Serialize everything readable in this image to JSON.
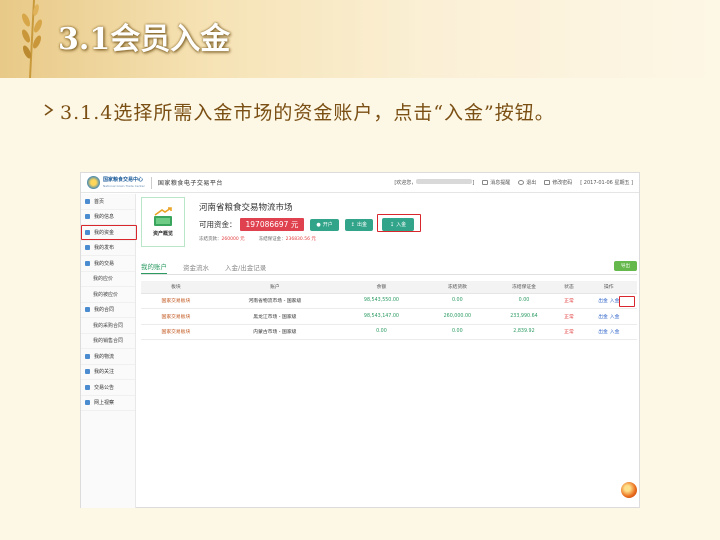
{
  "slide": {
    "title": "3.1会员入金",
    "subtitle": "3.1.4选择所需入金市场的资金账户，点击“入金”按钮。"
  },
  "app": {
    "logo_cn": "国家粮食交易中心",
    "logo_en": "National Grain Trade Center",
    "platform": "国家粮食电子交易平台",
    "welcome": "[欢迎您，",
    "messages": "消息提醒",
    "logout": "退出",
    "change_password": "修改密码",
    "date": "[ 2017-01-06 星期五 ]"
  },
  "sidebar": {
    "items": [
      {
        "label": "首页",
        "sub": false
      },
      {
        "label": "我的信息",
        "sub": false
      },
      {
        "label": "我的资金",
        "sub": false
      },
      {
        "label": "我的发布",
        "sub": false
      },
      {
        "label": "我的交易",
        "sub": false
      },
      {
        "label": "我的应价",
        "sub": true
      },
      {
        "label": "我的被应价",
        "sub": true
      },
      {
        "label": "我的合同",
        "sub": false
      },
      {
        "label": "我的采购合同",
        "sub": true
      },
      {
        "label": "我的销售合同",
        "sub": true
      },
      {
        "label": "我的物流",
        "sub": false
      },
      {
        "label": "我的关注",
        "sub": false
      },
      {
        "label": "交易公告",
        "sub": false
      },
      {
        "label": "网上视察",
        "sub": false
      }
    ]
  },
  "asset": {
    "label": "资产概览",
    "market": "河南省粮食交易物流市场",
    "available_label": "可用资金：",
    "available_amount": "197086697 元",
    "open_account": "开户",
    "withdraw": "出金",
    "deposit": "入金",
    "frozen_label": "冻结货款：",
    "frozen_value": "260000 元",
    "frozen_margin_label": "冻结保证金：",
    "frozen_margin_value": "236830.56 元"
  },
  "tabs": {
    "items": [
      "我的账户",
      "资金流水",
      "入金/出金记录"
    ],
    "export": "导出"
  },
  "table": {
    "headers": [
      "板块",
      "账户",
      "余额",
      "冻结货款",
      "冻结保证金",
      "状态",
      "操作"
    ],
    "rows": [
      {
        "board": "国家交易板块",
        "account": "河南省物流市场 - 国家级",
        "balance": "98,543,550.00",
        "frozen": "0.00",
        "margin": "0.00",
        "status": "正常",
        "op1": "出金",
        "op2": "入金"
      },
      {
        "board": "国家交易板块",
        "account": "黑龙江市场 - 国家级",
        "balance": "98,543,147.00",
        "frozen": "260,000.00",
        "margin": "233,990.64",
        "status": "正常",
        "op1": "出金",
        "op2": "入金"
      },
      {
        "board": "国家交易板块",
        "account": "内蒙古市场 - 国家级",
        "balance": "0.00",
        "frozen": "0.00",
        "margin": "2,839.92",
        "status": "正常",
        "op1": "出金",
        "op2": "入金"
      }
    ]
  }
}
